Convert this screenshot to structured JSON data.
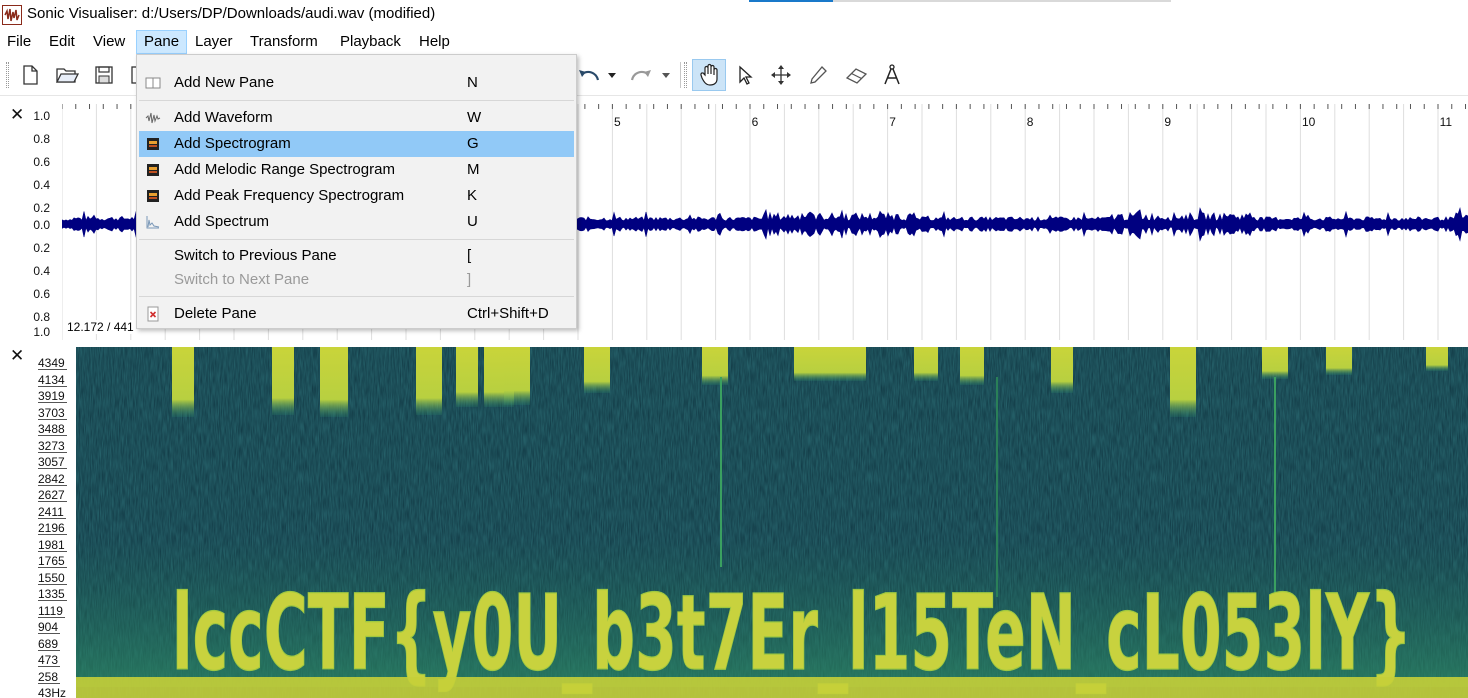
{
  "window": {
    "title": "Sonic Visualiser: d:/Users/DP/Downloads/audi.wav (modified)"
  },
  "menubar": {
    "items": [
      "File",
      "Edit",
      "View",
      "Pane",
      "Layer",
      "Transform",
      "Playback",
      "Help"
    ],
    "active": "Pane"
  },
  "toolbar": {
    "icons": [
      "new-file-icon",
      "open-folder-icon",
      "save-icon",
      "save-as-icon",
      "undo-icon",
      "undo-dropdown-icon",
      "redo-icon",
      "redo-dropdown-icon",
      "navigate-hand-icon",
      "select-arrow-icon",
      "move-cross-icon",
      "draw-pencil-icon",
      "erase-icon",
      "measure-compass-icon"
    ],
    "selected_tool": "navigate-hand-icon"
  },
  "pane_menu": {
    "items": [
      {
        "label": "Add New Pane",
        "shortcut": "N",
        "icon": "new-pane-icon",
        "enabled": true
      },
      {
        "label": "Add Waveform",
        "shortcut": "W",
        "icon": "waveform-icon",
        "enabled": true
      },
      {
        "label": "Add Spectrogram",
        "shortcut": "G",
        "icon": "spectrogram-icon",
        "enabled": true,
        "highlighted": true
      },
      {
        "label": "Add Melodic Range Spectrogram",
        "shortcut": "M",
        "icon": "melodic-spectrogram-icon",
        "enabled": true
      },
      {
        "label": "Add Peak Frequency Spectrogram",
        "shortcut": "K",
        "icon": "peak-spectrogram-icon",
        "enabled": true
      },
      {
        "label": "Add Spectrum",
        "shortcut": "U",
        "icon": "spectrum-icon",
        "enabled": true
      },
      {
        "label": "Switch to Previous Pane",
        "shortcut": "[",
        "enabled": true
      },
      {
        "label": "Switch to Next Pane",
        "shortcut": "]",
        "enabled": false
      },
      {
        "label": "Delete Pane",
        "shortcut": "Ctrl+Shift+D",
        "icon": "delete-pane-icon",
        "enabled": true
      }
    ]
  },
  "waveform_pane": {
    "close_symbol": "✕",
    "scale_labels": [
      "1.0",
      "0.8",
      "0.6",
      "0.4",
      "0.2",
      "0.0",
      "0.2",
      "0.4",
      "0.6",
      "0.8",
      "1.0"
    ],
    "time_ruler": [
      "5",
      "6",
      "7",
      "8",
      "9",
      "10",
      "11"
    ],
    "readout": "12.172 / 441",
    "wave_color": "#000080"
  },
  "spectrogram_pane": {
    "close_symbol": "✕",
    "freq_labels": [
      "4349",
      "4134",
      "3919",
      "3703",
      "3488",
      "3273",
      "3057",
      "2842",
      "2627",
      "2411",
      "2196",
      "1981",
      "1765",
      "1550",
      "1335",
      "1119",
      "904",
      "689",
      "473",
      "258",
      "43Hz"
    ],
    "hidden_text": "lccCTF{y0U_b3t7Er_l15TeN_cL053lY}"
  }
}
